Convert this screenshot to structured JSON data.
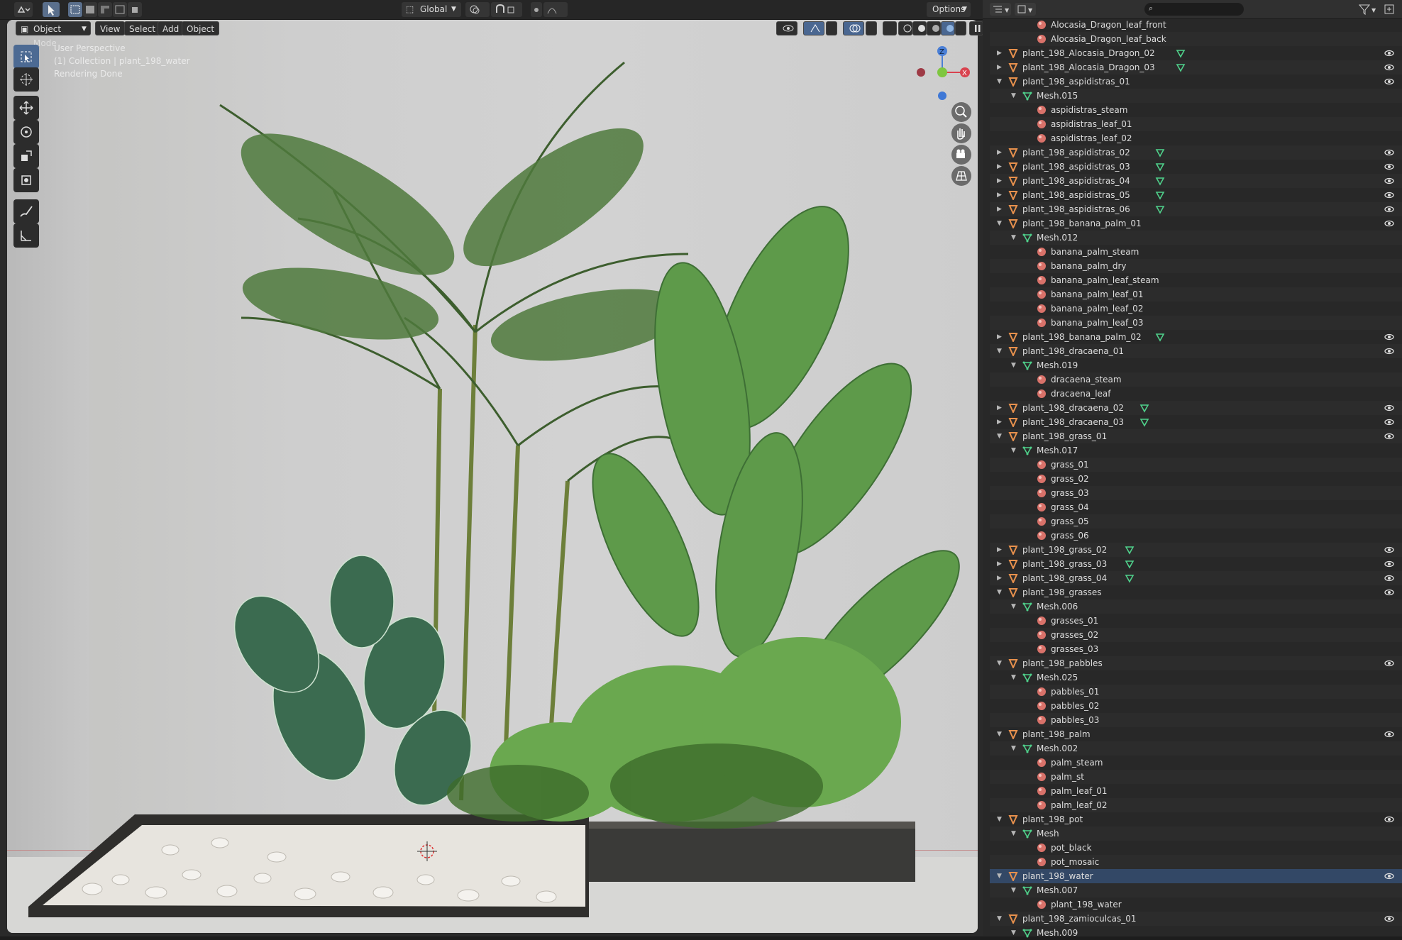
{
  "viewport": {
    "header": {
      "transform_orientation": "Global",
      "options_label": "Options",
      "mode_label": "Object Mode",
      "menus": [
        "View",
        "Select",
        "Add",
        "Object"
      ]
    },
    "overlay": {
      "perspective": "User Perspective",
      "collection_info": "(1) Collection | plant_198_water",
      "status": "Rendering Done"
    },
    "gizmo": {
      "x_label": "X",
      "z_label": "Z"
    },
    "tools": [
      "select-box-icon",
      "cursor-icon",
      "move-icon",
      "rotate-icon",
      "scale-icon",
      "transform-icon",
      "annotate-icon",
      "measure-icon"
    ]
  },
  "colors": {
    "object_icon": "#e8914d",
    "mesh_icon": "#4fd18b",
    "material_icon": "#d9726a",
    "active_tool": "#4c6a93"
  },
  "outliner": {
    "rows": [
      {
        "level": 3,
        "type": "material",
        "label": "Alocasia_Dragon_leaf_front",
        "expand": "none"
      },
      {
        "level": 3,
        "type": "material",
        "label": "Alocasia_Dragon_leaf_back",
        "expand": "none"
      },
      {
        "level": 1,
        "type": "object",
        "label": "plant_198_Alocasia_Dragon_02",
        "expand": "closed",
        "mesh_badge": true,
        "eye": true
      },
      {
        "level": 1,
        "type": "object",
        "label": "plant_198_Alocasia_Dragon_03",
        "expand": "closed",
        "mesh_badge": true,
        "eye": true
      },
      {
        "level": 1,
        "type": "object",
        "label": "plant_198_aspidistras_01",
        "expand": "open",
        "eye": true
      },
      {
        "level": 2,
        "type": "mesh",
        "label": "Mesh.015",
        "expand": "open"
      },
      {
        "level": 3,
        "type": "material",
        "label": "aspidistras_steam",
        "expand": "none"
      },
      {
        "level": 3,
        "type": "material",
        "label": "aspidistras_leaf_01",
        "expand": "none"
      },
      {
        "level": 3,
        "type": "material",
        "label": "aspidistras_leaf_02",
        "expand": "none"
      },
      {
        "level": 1,
        "type": "object",
        "label": "plant_198_aspidistras_02",
        "expand": "closed",
        "mesh_badge": true,
        "eye": true
      },
      {
        "level": 1,
        "type": "object",
        "label": "plant_198_aspidistras_03",
        "expand": "closed",
        "mesh_badge": true,
        "eye": true
      },
      {
        "level": 1,
        "type": "object",
        "label": "plant_198_aspidistras_04",
        "expand": "closed",
        "mesh_badge": true,
        "eye": true
      },
      {
        "level": 1,
        "type": "object",
        "label": "plant_198_aspidistras_05",
        "expand": "closed",
        "mesh_badge": true,
        "eye": true
      },
      {
        "level": 1,
        "type": "object",
        "label": "plant_198_aspidistras_06",
        "expand": "closed",
        "mesh_badge": true,
        "eye": true
      },
      {
        "level": 1,
        "type": "object",
        "label": "plant_198_banana_palm_01",
        "expand": "open",
        "eye": true
      },
      {
        "level": 2,
        "type": "mesh",
        "label": "Mesh.012",
        "expand": "open"
      },
      {
        "level": 3,
        "type": "material",
        "label": "banana_palm_steam",
        "expand": "none"
      },
      {
        "level": 3,
        "type": "material",
        "label": "banana_palm_dry",
        "expand": "none"
      },
      {
        "level": 3,
        "type": "material",
        "label": "banana_palm_leaf_steam",
        "expand": "none"
      },
      {
        "level": 3,
        "type": "material",
        "label": "banana_palm_leaf_01",
        "expand": "none"
      },
      {
        "level": 3,
        "type": "material",
        "label": "banana_palm_leaf_02",
        "expand": "none"
      },
      {
        "level": 3,
        "type": "material",
        "label": "banana_palm_leaf_03",
        "expand": "none"
      },
      {
        "level": 1,
        "type": "object",
        "label": "plant_198_banana_palm_02",
        "expand": "closed",
        "mesh_badge": true,
        "eye": true
      },
      {
        "level": 1,
        "type": "object",
        "label": "plant_198_dracaena_01",
        "expand": "open",
        "eye": true
      },
      {
        "level": 2,
        "type": "mesh",
        "label": "Mesh.019",
        "expand": "open"
      },
      {
        "level": 3,
        "type": "material",
        "label": "dracaena_steam",
        "expand": "none"
      },
      {
        "level": 3,
        "type": "material",
        "label": "dracaena_leaf",
        "expand": "none"
      },
      {
        "level": 1,
        "type": "object",
        "label": "plant_198_dracaena_02",
        "expand": "closed",
        "mesh_badge": true,
        "eye": true
      },
      {
        "level": 1,
        "type": "object",
        "label": "plant_198_dracaena_03",
        "expand": "closed",
        "mesh_badge": true,
        "eye": true
      },
      {
        "level": 1,
        "type": "object",
        "label": "plant_198_grass_01",
        "expand": "open",
        "eye": true
      },
      {
        "level": 2,
        "type": "mesh",
        "label": "Mesh.017",
        "expand": "open"
      },
      {
        "level": 3,
        "type": "material",
        "label": "grass_01",
        "expand": "none"
      },
      {
        "level": 3,
        "type": "material",
        "label": "grass_02",
        "expand": "none"
      },
      {
        "level": 3,
        "type": "material",
        "label": "grass_03",
        "expand": "none"
      },
      {
        "level": 3,
        "type": "material",
        "label": "grass_04",
        "expand": "none"
      },
      {
        "level": 3,
        "type": "material",
        "label": "grass_05",
        "expand": "none"
      },
      {
        "level": 3,
        "type": "material",
        "label": "grass_06",
        "expand": "none"
      },
      {
        "level": 1,
        "type": "object",
        "label": "plant_198_grass_02",
        "expand": "closed",
        "mesh_badge": true,
        "eye": true
      },
      {
        "level": 1,
        "type": "object",
        "label": "plant_198_grass_03",
        "expand": "closed",
        "mesh_badge": true,
        "eye": true
      },
      {
        "level": 1,
        "type": "object",
        "label": "plant_198_grass_04",
        "expand": "closed",
        "mesh_badge": true,
        "eye": true
      },
      {
        "level": 1,
        "type": "object",
        "label": "plant_198_grasses",
        "expand": "open",
        "eye": true
      },
      {
        "level": 2,
        "type": "mesh",
        "label": "Mesh.006",
        "expand": "open"
      },
      {
        "level": 3,
        "type": "material",
        "label": "grasses_01",
        "expand": "none"
      },
      {
        "level": 3,
        "type": "material",
        "label": "grasses_02",
        "expand": "none"
      },
      {
        "level": 3,
        "type": "material",
        "label": "grasses_03",
        "expand": "none"
      },
      {
        "level": 1,
        "type": "object",
        "label": "plant_198_pabbles",
        "expand": "open",
        "eye": true
      },
      {
        "level": 2,
        "type": "mesh",
        "label": "Mesh.025",
        "expand": "open"
      },
      {
        "level": 3,
        "type": "material",
        "label": "pabbles_01",
        "expand": "none"
      },
      {
        "level": 3,
        "type": "material",
        "label": "pabbles_02",
        "expand": "none"
      },
      {
        "level": 3,
        "type": "material",
        "label": "pabbles_03",
        "expand": "none"
      },
      {
        "level": 1,
        "type": "object",
        "label": "plant_198_palm",
        "expand": "open",
        "eye": true
      },
      {
        "level": 2,
        "type": "mesh",
        "label": "Mesh.002",
        "expand": "open"
      },
      {
        "level": 3,
        "type": "material",
        "label": "palm_steam",
        "expand": "none"
      },
      {
        "level": 3,
        "type": "material",
        "label": "palm_st",
        "expand": "none"
      },
      {
        "level": 3,
        "type": "material",
        "label": "palm_leaf_01",
        "expand": "none"
      },
      {
        "level": 3,
        "type": "material",
        "label": "palm_leaf_02",
        "expand": "none"
      },
      {
        "level": 1,
        "type": "object",
        "label": "plant_198_pot",
        "expand": "open",
        "eye": true
      },
      {
        "level": 2,
        "type": "mesh",
        "label": "Mesh",
        "expand": "open"
      },
      {
        "level": 3,
        "type": "material",
        "label": "pot_black",
        "expand": "none"
      },
      {
        "level": 3,
        "type": "material",
        "label": "pot_mosaic",
        "expand": "none"
      },
      {
        "level": 1,
        "type": "object",
        "label": "plant_198_water",
        "expand": "open",
        "eye": true,
        "active": true
      },
      {
        "level": 2,
        "type": "mesh",
        "label": "Mesh.007",
        "expand": "open"
      },
      {
        "level": 3,
        "type": "material",
        "label": "plant_198_water",
        "expand": "none"
      },
      {
        "level": 1,
        "type": "object",
        "label": "plant_198_zamioculcas_01",
        "expand": "open",
        "eye": true
      },
      {
        "level": 2,
        "type": "mesh",
        "label": "Mesh.009",
        "expand": "open"
      }
    ]
  }
}
